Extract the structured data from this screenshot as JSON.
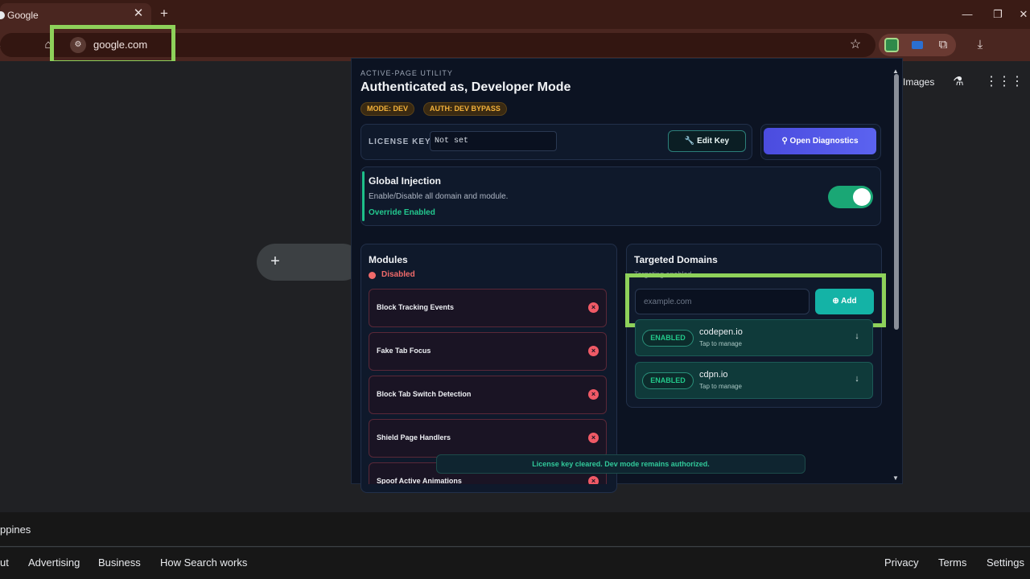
{
  "browser": {
    "tab": {
      "title": "Google",
      "close_glyph": "✕",
      "new_tab_glyph": "+"
    },
    "window_controls": {
      "minimize": "—",
      "restore": "❐",
      "close": "✕"
    },
    "nav": {
      "back": "←",
      "reload": "⟳",
      "home": "⌂"
    },
    "omnibox": {
      "url": "google.com",
      "site_info_glyph": "⚙",
      "bookmark_glyph": "☆"
    },
    "toolbar": {
      "extensions_glyph": "⧉",
      "download_glyph": "⤓"
    }
  },
  "google_page": {
    "images_link": "Images",
    "labs_glyph": "⚗",
    "apps_glyph": "⋮⋮⋮",
    "shortcut_add_glyph": "+",
    "footer_country": "ppines",
    "footer_links_left": [
      "ut",
      "Advertising",
      "Business",
      "How Search works"
    ],
    "footer_links_right": [
      "Privacy",
      "Terms",
      "Settings"
    ]
  },
  "popup": {
    "eyebrow": "ACTIVE-PAGE UTILITY",
    "title": "Authenticated as, Developer Mode",
    "pills": [
      "MODE: DEV",
      "AUTH: DEV BYPASS"
    ],
    "license": {
      "label": "LICENSE KEY",
      "value": "Not set",
      "edit_button": "🔧 Edit Key",
      "diagnostics_button": "⚲ Open Diagnostics"
    },
    "global_injection": {
      "title": "Global Injection",
      "description": "Enable/Disable all domain and module.",
      "status": "Override Enabled",
      "toggle_on": true
    },
    "modules": {
      "title": "Modules",
      "status": "Disabled",
      "items": [
        {
          "label": "Block Tracking Events"
        },
        {
          "label": "Fake Tab Focus"
        },
        {
          "label": "Block Tab Switch Detection"
        },
        {
          "label": "Shield Page Handlers"
        },
        {
          "label": "Spoof Active Animations"
        }
      ],
      "remove_glyph": "×"
    },
    "domains": {
      "title": "Targeted Domains",
      "subtitle": "Targeting enabled",
      "input_placeholder": "example.com",
      "add_button": "⊕  Add",
      "items": [
        {
          "badge": "ENABLED",
          "name": "codepen.io",
          "hint": "Tap to manage"
        },
        {
          "badge": "ENABLED",
          "name": "cdpn.io",
          "hint": "Tap to manage"
        }
      ],
      "chevron_glyph": "↓"
    },
    "toast": "License key cleared. Dev mode remains authorized.",
    "scroll": {
      "up": "▲",
      "down": "▼"
    }
  },
  "colors": {
    "tab_bar": "#3a1b15",
    "toolbar": "#4a2620",
    "highlight": "#8ed15a",
    "popup_bg": "#0c1322",
    "accent_green": "#23c98f",
    "danger": "#f06a6a",
    "diag_button": "#5b63f0",
    "add_button": "#14b3a6"
  }
}
